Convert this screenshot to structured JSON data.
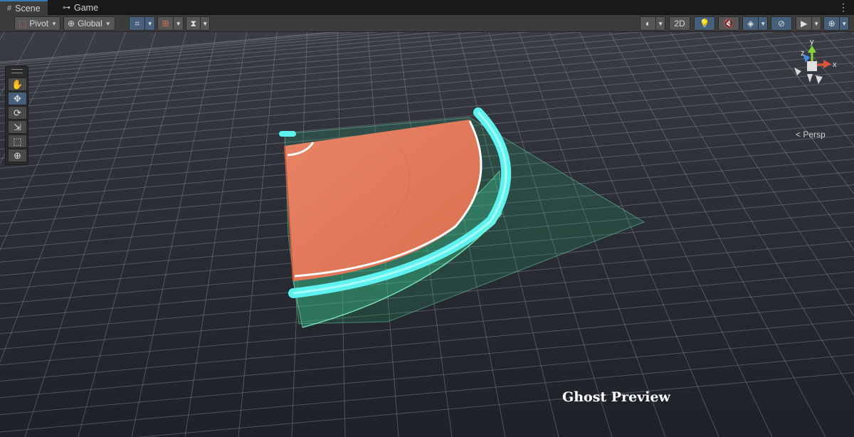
{
  "tabs": [
    {
      "label": "Scene",
      "icon": "grid-icon"
    },
    {
      "label": "Game",
      "icon": "gamepad-icon"
    }
  ],
  "toolbar": {
    "pivot": "Pivot",
    "global": "Global",
    "twod": "2D"
  },
  "tools": [
    {
      "name": "hand-tool",
      "icon": "hand-icon",
      "glyph": "✋"
    },
    {
      "name": "move-tool",
      "icon": "move-icon",
      "glyph": "✥"
    },
    {
      "name": "rotate-tool",
      "icon": "rotate-icon",
      "glyph": "⟳"
    },
    {
      "name": "scale-tool",
      "icon": "scale-icon",
      "glyph": "⇲"
    },
    {
      "name": "rect-tool",
      "icon": "rect-icon",
      "glyph": "⬚"
    },
    {
      "name": "transform-tool",
      "icon": "transform-icon",
      "glyph": "⊕"
    }
  ],
  "active_tool": "move-tool",
  "gizmo": {
    "x": "x",
    "y": "y",
    "z": "z",
    "projection": "Persp"
  },
  "overlay_label": "Ghost Preview",
  "colors": {
    "accent": "#46607c",
    "tab_highlight": "#3a79bb",
    "court": "#e07a5f",
    "ghost": "#3fd19a",
    "rim": "#5ef2ee",
    "grid_bg": "#2b2f36"
  }
}
